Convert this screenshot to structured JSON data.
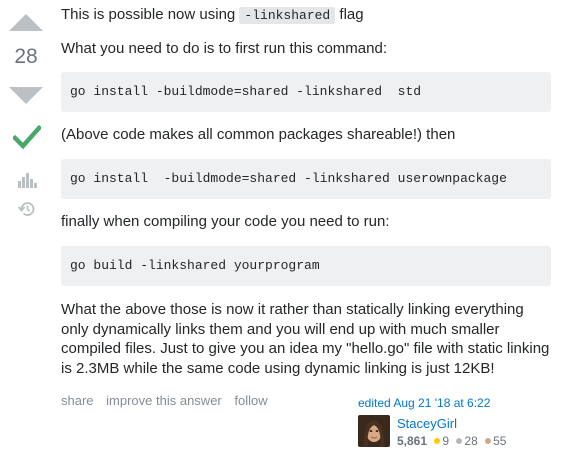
{
  "vote": {
    "count": "28"
  },
  "post": {
    "p1_before": "This is possible now using ",
    "p1_code": "-linkshared",
    "p1_after": " flag",
    "p2": "What you need to do is to first run this command:",
    "code1": "go install -buildmode=shared -linkshared  std",
    "p3": "(Above code makes all common packages shareable!) then",
    "code2": "go install  -buildmode=shared -linkshared userownpackage",
    "p4": "finally when compiling your code you need to run:",
    "code3": "go build -linkshared yourprogram",
    "p5": "What the above those is now it rather than statically linking everything only dynamically links them and you will end up with much smaller compiled files. Just to give you an idea my \"hello.go\" file with static linking is 2.3MB while the same code using dynamic linking is just 12KB!"
  },
  "menu": {
    "share": "share",
    "improve": "improve this answer",
    "follow": "follow"
  },
  "edit": {
    "edited": "edited Aug 21 '18 at 6:22",
    "user_name": "StaceyGirl",
    "reputation": "5,861",
    "gold": "9",
    "silver": "28",
    "bronze": "55"
  },
  "colors": {
    "accepted": "#48a868",
    "gold": "#ffcc01",
    "silver": "#b4b8bc",
    "bronze": "#d1a684",
    "link": "#0077cc"
  },
  "icons": {
    "up": "arrow-up-icon",
    "down": "arrow-down-icon",
    "accepted": "checkmark-icon",
    "bounty": "bounty-icon",
    "history": "history-icon"
  }
}
